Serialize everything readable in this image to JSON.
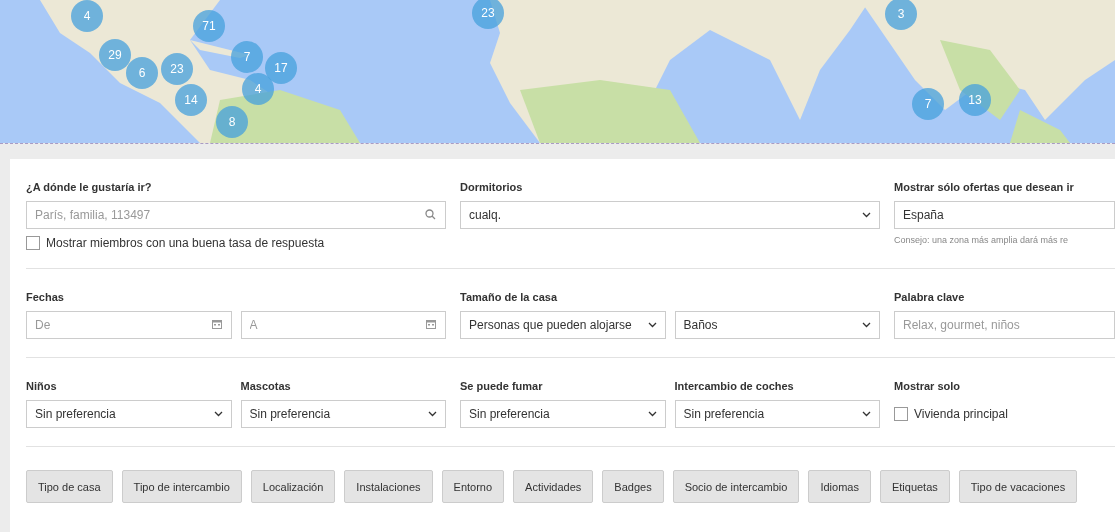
{
  "map": {
    "kind": "picture",
    "markers": [
      {
        "count": "4"
      },
      {
        "count": "71"
      },
      {
        "count": "29"
      },
      {
        "count": "6"
      },
      {
        "count": "23"
      },
      {
        "count": "7"
      },
      {
        "count": "17"
      },
      {
        "count": "14"
      },
      {
        "count": "4"
      },
      {
        "count": "8"
      },
      {
        "count": "23"
      },
      {
        "count": "3"
      },
      {
        "count": "7"
      },
      {
        "count": "13"
      }
    ]
  },
  "filters": [
    [
      [
        {
          "label": "¿A dónde le gustaría ir?",
          "controls": [
            {
              "kind": "search",
              "placeholder": "París, familia, 113497"
            }
          ],
          "option": {
            "label": "Mostrar miembros con una buena tasa de respuesta",
            "checked": false
          }
        }
      ],
      [
        {
          "label": "Dormitorios",
          "controls": [
            {
              "kind": "select",
              "value": "cualq."
            }
          ]
        }
      ],
      [
        {
          "label": "Mostrar sólo ofertas que desean ir",
          "controls": [
            {
              "kind": "text",
              "value": "España"
            }
          ],
          "hint": "Consejo: una zona más amplia dará más re"
        }
      ]
    ],
    [
      [
        {
          "label": "Fechas",
          "controls": [
            {
              "kind": "date",
              "placeholder": "De"
            },
            {
              "kind": "date",
              "placeholder": "A"
            }
          ]
        }
      ],
      [
        {
          "label": "Tamaño de la casa",
          "controls": [
            {
              "kind": "select",
              "value": "Personas que pueden alojarse"
            },
            {
              "kind": "select",
              "value": "Baños"
            }
          ]
        }
      ],
      [
        {
          "label": "Palabra clave",
          "controls": [
            {
              "kind": "text",
              "placeholder": "Relax, gourmet, niños"
            }
          ]
        }
      ]
    ],
    [
      [
        {
          "label": "Niños",
          "controls": [
            {
              "kind": "select",
              "value": "Sin preferencia"
            }
          ]
        },
        {
          "label": "Mascotas",
          "controls": [
            {
              "kind": "select",
              "value": "Sin preferencia"
            }
          ]
        }
      ],
      [
        {
          "label": "Se puede fumar",
          "controls": [
            {
              "kind": "select",
              "value": "Sin preferencia"
            }
          ]
        },
        {
          "label": "Intercambio de coches",
          "controls": [
            {
              "kind": "select",
              "value": "Sin preferencia"
            }
          ]
        }
      ],
      [
        {
          "label": "Mostrar solo",
          "controls": [
            {
              "kind": "checkbox",
              "label": "Vivienda principal",
              "checked": false
            }
          ]
        }
      ]
    ]
  ],
  "buttons": [
    "Tipo de casa",
    "Tipo de intercambio",
    "Localización",
    "Instalaciones",
    "Entorno",
    "Actividades",
    "Badges",
    "Socio de intercambio",
    "Idiomas",
    "Etiquetas",
    "Tipo de vacaciones"
  ]
}
